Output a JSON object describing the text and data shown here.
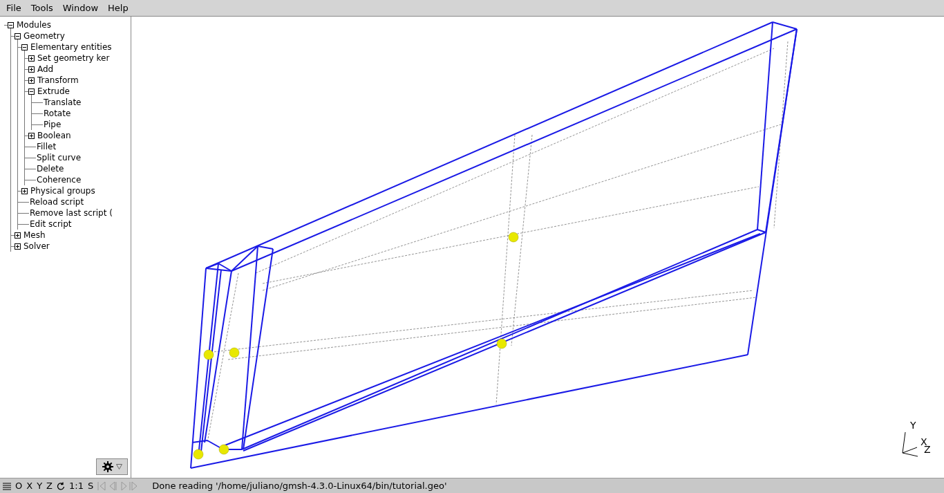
{
  "menu": [
    "File",
    "Tools",
    "Window",
    "Help"
  ],
  "tree": [
    {
      "label": "Modules",
      "kind": "branch",
      "expanded": true,
      "children": [
        {
          "label": "Geometry",
          "kind": "branch",
          "expanded": true,
          "children": [
            {
              "label": "Elementary entities",
              "kind": "branch",
              "expanded": true,
              "children": [
                {
                  "label": "Set geometry ker",
                  "kind": "branch",
                  "expanded": false
                },
                {
                  "label": "Add",
                  "kind": "branch",
                  "expanded": false
                },
                {
                  "label": "Transform",
                  "kind": "branch",
                  "expanded": false
                },
                {
                  "label": "Extrude",
                  "kind": "branch",
                  "expanded": true,
                  "children": [
                    {
                      "label": "Translate",
                      "kind": "leaf"
                    },
                    {
                      "label": "Rotate",
                      "kind": "leaf"
                    },
                    {
                      "label": "Pipe",
                      "kind": "leaf"
                    }
                  ]
                },
                {
                  "label": "Boolean",
                  "kind": "branch",
                  "expanded": false
                },
                {
                  "label": "Fillet",
                  "kind": "leaf"
                },
                {
                  "label": "Split curve",
                  "kind": "leaf"
                },
                {
                  "label": "Delete",
                  "kind": "leaf"
                },
                {
                  "label": "Coherence",
                  "kind": "leaf"
                }
              ]
            },
            {
              "label": "Physical groups",
              "kind": "branch",
              "expanded": false
            },
            {
              "label": "Reload script",
              "kind": "leaf"
            },
            {
              "label": "Remove last script (",
              "kind": "leaf"
            },
            {
              "label": "Edit script",
              "kind": "leaf"
            }
          ]
        },
        {
          "label": "Mesh",
          "kind": "branch",
          "expanded": false
        },
        {
          "label": "Solver",
          "kind": "branch",
          "expanded": false
        }
      ]
    }
  ],
  "axes": {
    "labels": [
      "Y",
      "X",
      "Z"
    ]
  },
  "status_bar": {
    "view_buttons": [
      "O",
      "X",
      "Y",
      "Z"
    ],
    "scale": "1:1",
    "snap": "S",
    "message": "Done reading '/home/juliano/gmsh-4.3.0-Linux64/bin/tutorial.geo'"
  }
}
